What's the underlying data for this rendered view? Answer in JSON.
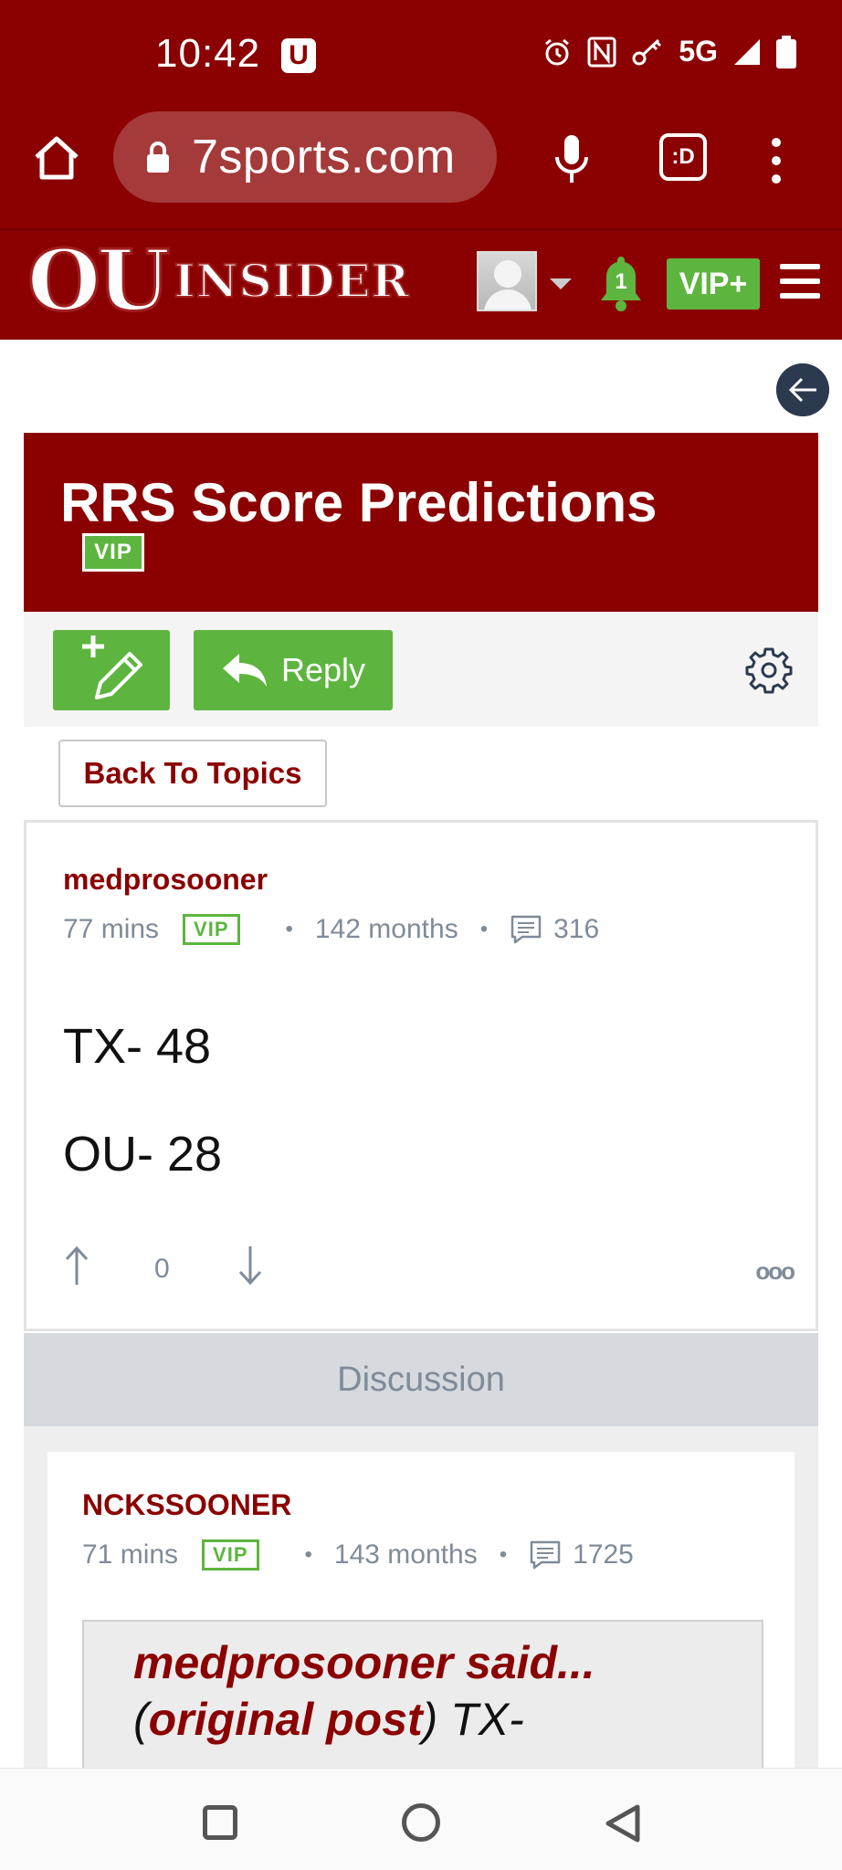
{
  "status_bar": {
    "time": "10:42",
    "app_badge": "U",
    "network": "5G",
    "icons": [
      "alarm-icon",
      "nfc-icon",
      "key-icon",
      "signal-icon",
      "battery-icon"
    ]
  },
  "browser": {
    "url": "7sports.com",
    "tabs_label": ":D"
  },
  "site_header": {
    "logo_ou": "OU",
    "logo_insider": "INSIDER",
    "notification_count": "1",
    "vip_plus_label": "VIP+"
  },
  "thread": {
    "title": "RRS Score Predictions",
    "badge": "VIP",
    "reply_label": "Reply",
    "back_to_topics": "Back To Topics"
  },
  "post": {
    "author": "medprosooner",
    "time": "77 mins",
    "badge": "VIP",
    "tenure": "142 months",
    "post_count": "316",
    "body_line1": "TX- 48",
    "body_line2": "OU- 28",
    "vote_count": "0",
    "more_label": "ooo"
  },
  "discussion_label": "Discussion",
  "reply": {
    "author": "NCKSSOONER",
    "time": "71 mins",
    "badge": "VIP",
    "tenure": "143 months",
    "post_count": "1725",
    "quote_line1": "medprosooner said...",
    "quote_link": "original post",
    "quote_open": "(",
    "quote_rest": ") TX-"
  },
  "colors": {
    "brand_red": "#8b0000",
    "vip_green": "#5db53f",
    "meta_gray": "#7f8b98"
  }
}
